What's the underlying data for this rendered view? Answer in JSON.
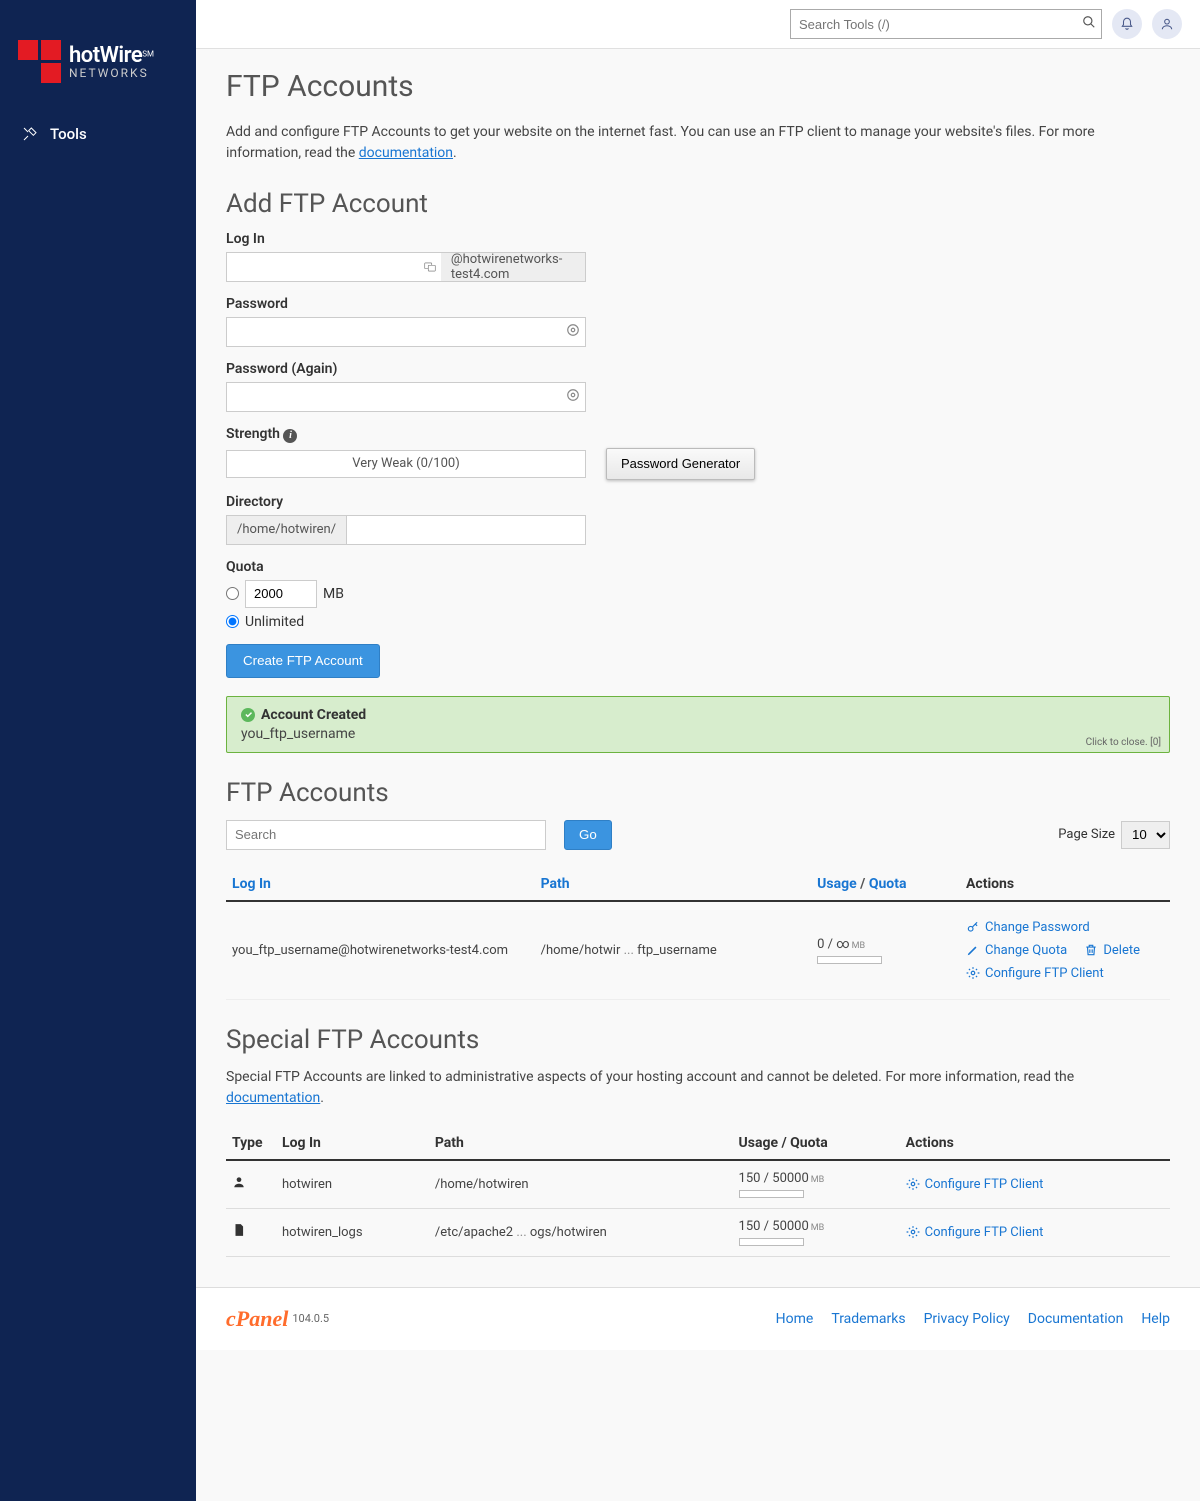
{
  "brand": {
    "name": "hotWire",
    "sub": "NETWORKS",
    "sm": "SM"
  },
  "nav": {
    "tools": "Tools"
  },
  "topbar": {
    "search_placeholder": "Search Tools (/)"
  },
  "page": {
    "title": "FTP Accounts",
    "intro_a": "Add and configure FTP Accounts to get your website on the internet fast. You can use an FTP client to manage your website's files. For more information, read the ",
    "intro_link": "documentation",
    "intro_b": "."
  },
  "add": {
    "heading": "Add FTP Account",
    "login_label": "Log In",
    "login_domain": "@hotwirenetworks-test4.com",
    "password_label": "Password",
    "password_again_label": "Password (Again)",
    "strength_label": "Strength",
    "strength_text": "Very Weak (0/100)",
    "gen_btn": "Password Generator",
    "directory_label": "Directory",
    "directory_prefix": "/home/hotwiren/",
    "quota_label": "Quota",
    "quota_value": "2000",
    "quota_unit": "MB",
    "quota_unlimited": "Unlimited",
    "create_btn": "Create FTP Account"
  },
  "alert": {
    "title": "Account Created",
    "msg": "you_ftp_username",
    "close": "Click to close. [0]"
  },
  "list": {
    "heading": "FTP Accounts",
    "search_placeholder": "Search",
    "go": "Go",
    "page_size_label": "Page Size",
    "page_size_value": "10",
    "cols": {
      "login": "Log In",
      "path": "Path",
      "usage": "Usage",
      "quota": "Quota",
      "actions": "Actions"
    },
    "row": {
      "login": "you_ftp_username@hotwirenetworks-test4.com",
      "path_a": "/home/hotwir",
      "path_b": "ftp_username",
      "usage": "0 / ∞",
      "actions": {
        "cp": "Change Password",
        "cq": "Change Quota",
        "del": "Delete",
        "cfg": "Configure FTP Client"
      }
    }
  },
  "special": {
    "heading": "Special FTP Accounts",
    "intro_a": "Special FTP Accounts are linked to administrative aspects of your hosting account and cannot be deleted. For more information, read the ",
    "intro_link": "documentation",
    "intro_b": ".",
    "cols": {
      "type": "Type",
      "login": "Log In",
      "path": "Path",
      "usage": "Usage / Quota",
      "actions": "Actions"
    },
    "rows": [
      {
        "login": "hotwiren",
        "path": "/home/hotwiren",
        "usage": "150 / 50000",
        "action": "Configure FTP Client"
      },
      {
        "login": "hotwiren_logs",
        "path_a": "/etc/apache2",
        "path_b": "ogs/hotwiren",
        "usage": "150 / 50000",
        "action": "Configure FTP Client"
      }
    ]
  },
  "footer": {
    "cpanel": "cPanel",
    "version": "104.0.5",
    "links": [
      "Home",
      "Trademarks",
      "Privacy Policy",
      "Documentation",
      "Help"
    ]
  },
  "unit_mb": "MB"
}
